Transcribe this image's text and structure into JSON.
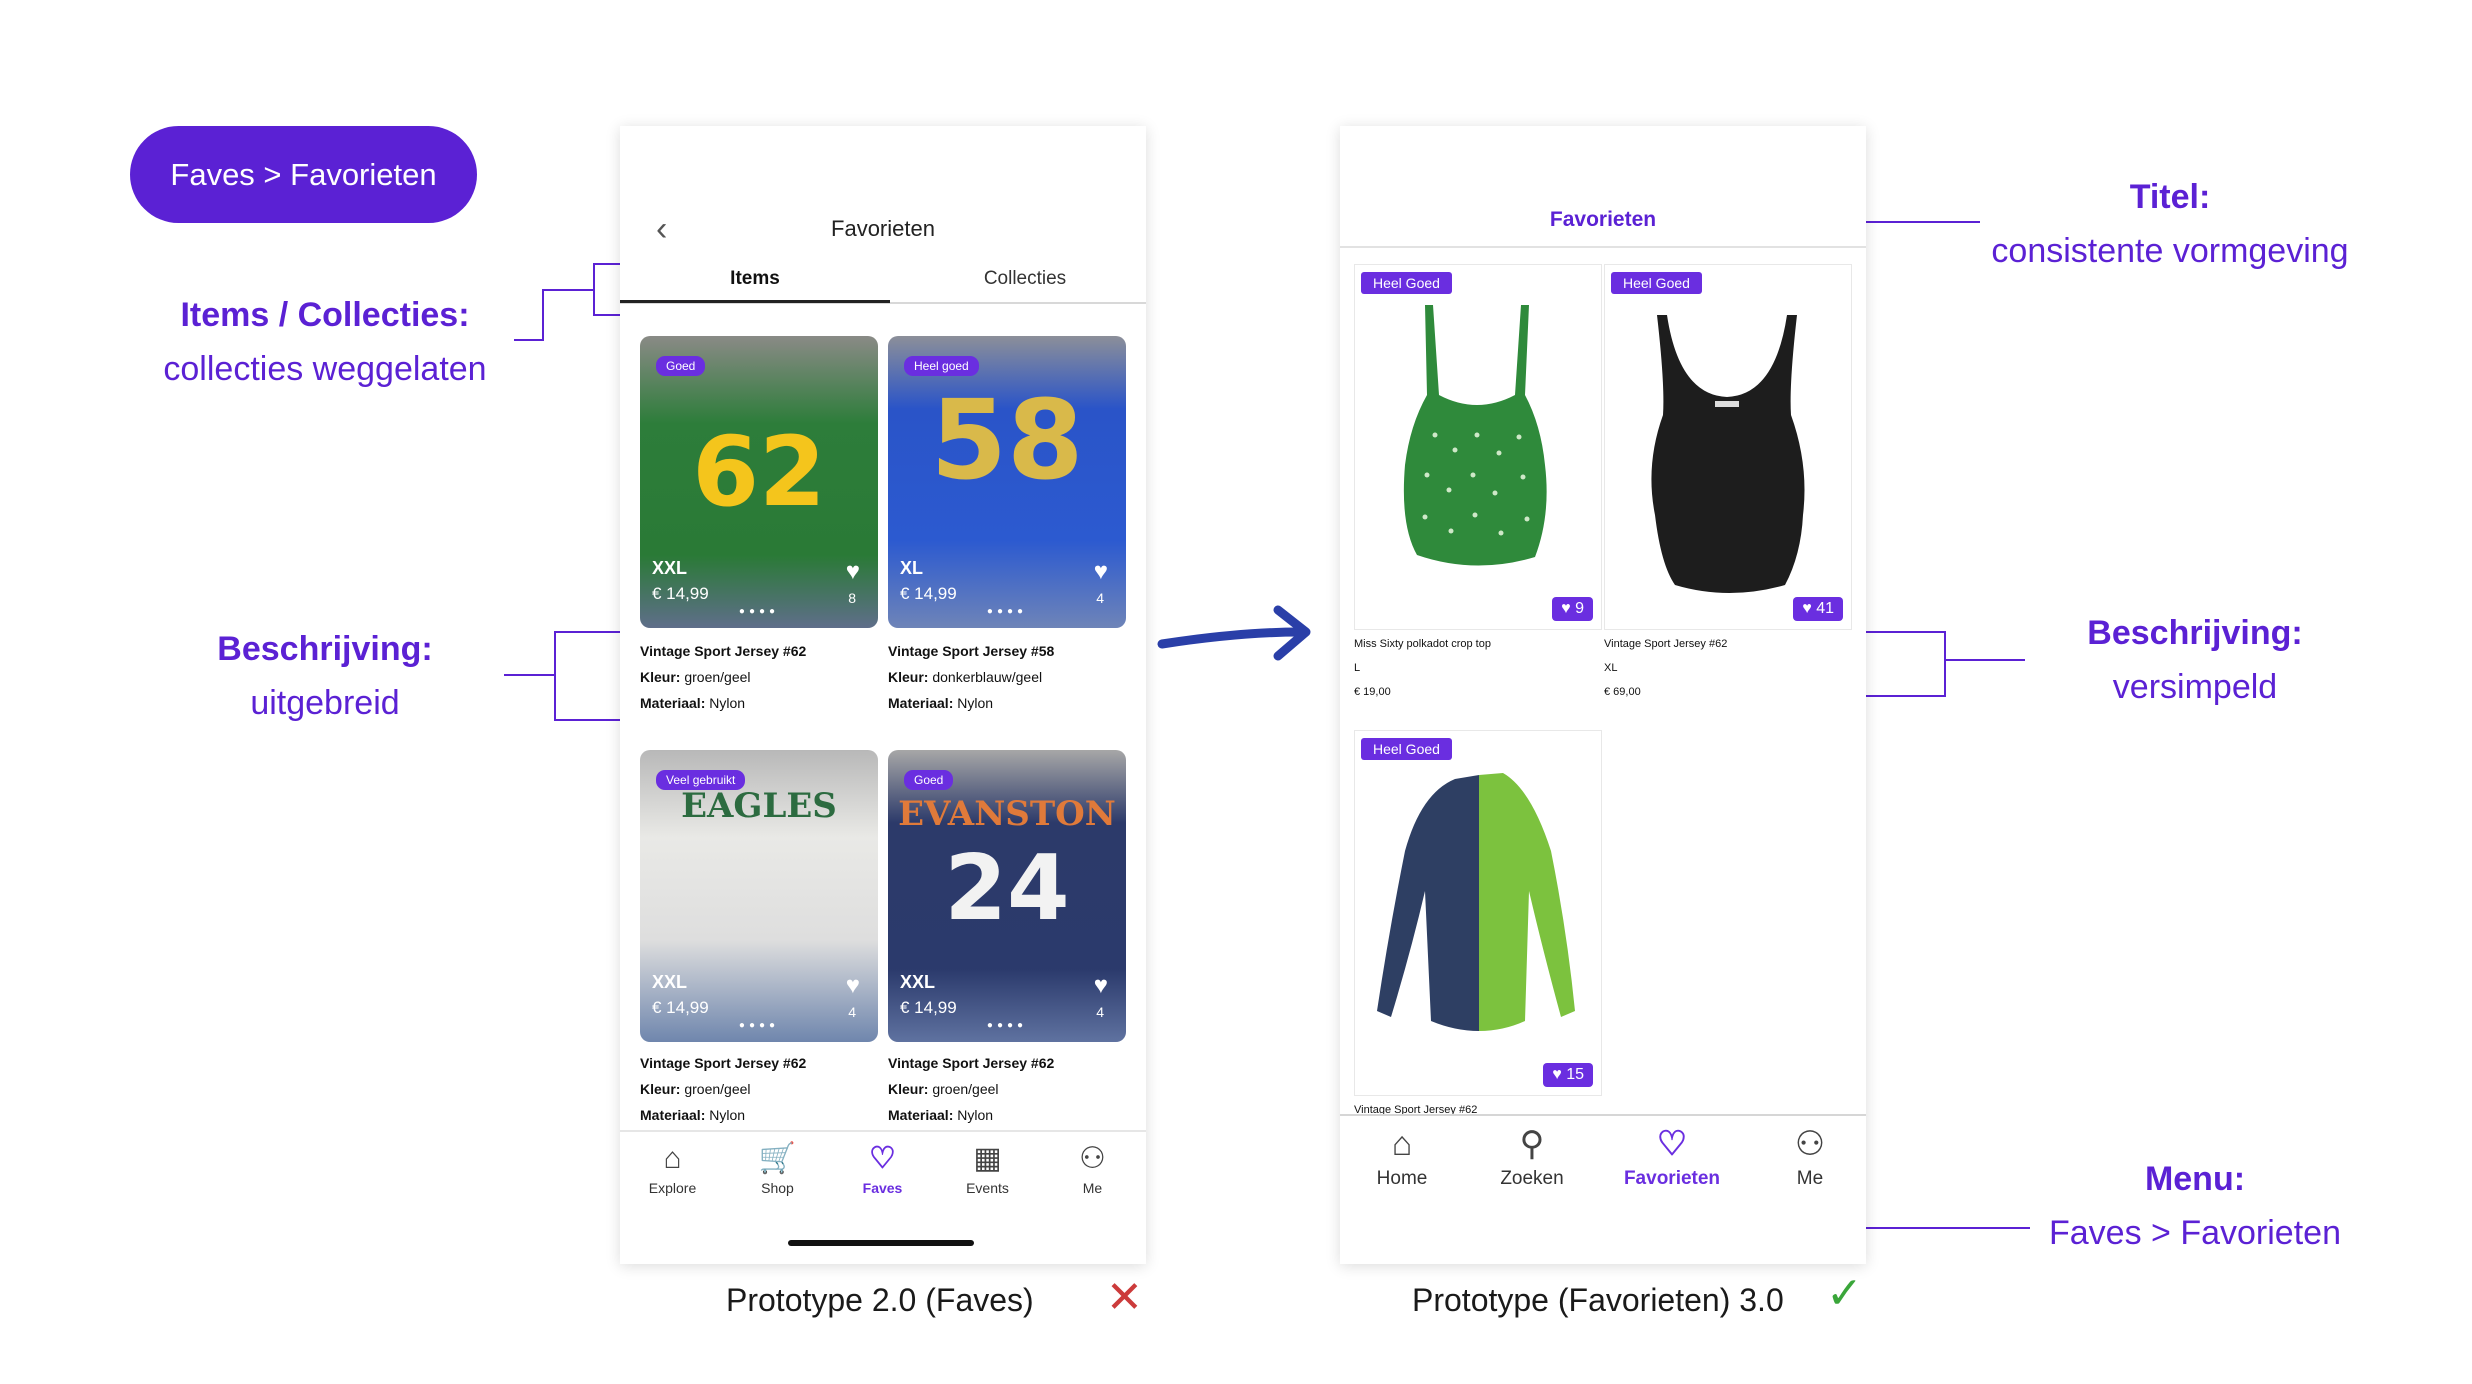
{
  "pill": "Faves > Favorieten",
  "annotations": {
    "items_title": "Items / Collecties:",
    "items_sub": "collecties weggelaten",
    "desc_left_title": "Beschrijving:",
    "desc_left_sub": "uitgebreid",
    "titel_title": "Titel:",
    "titel_sub": "consistente vormgeving",
    "desc_right_title": "Beschrijving:",
    "desc_right_sub": "versimpeld",
    "menu_title": "Menu:",
    "menu_sub": "Faves > Favorieten"
  },
  "captions": {
    "left": "Prototype 2.0 (Faves)",
    "left_mark": "✕",
    "right": "Prototype (Favorieten) 3.0",
    "right_mark": "✓"
  },
  "colors": {
    "accent": "#5b21d4",
    "badge": "#6a2ee0",
    "arrow": "#2a3fa8",
    "cross": "#cc3b3b",
    "check": "#3aa63a"
  },
  "phone_a": {
    "back_icon": "chevron-left-icon",
    "title": "Favorieten",
    "tabs": [
      "Items",
      "Collecties"
    ],
    "cards": [
      {
        "badge": "Goed",
        "size": "XXL",
        "price": "€ 14,99",
        "count": "8",
        "number": "62",
        "name": "Vintage Sport Jersey #62",
        "kleur_label": "Kleur:",
        "kleur": "groen/geel",
        "materiaal_label": "Materiaal:",
        "materiaal": "Nylon"
      },
      {
        "badge": "Heel goed",
        "size": "XL",
        "price": "€ 14,99",
        "count": "4",
        "number": "58",
        "name": "Vintage Sport Jersey #58",
        "kleur_label": "Kleur:",
        "kleur": "donkerblauw/geel",
        "materiaal_label": "Materiaal:",
        "materiaal": "Nylon"
      },
      {
        "badge": "Veel gebruikt",
        "size": "XXL",
        "price": "€ 14,99",
        "count": "4",
        "number": "EAGLES",
        "name": "Vintage Sport Jersey #62",
        "kleur_label": "Kleur:",
        "kleur": "groen/geel",
        "materiaal_label": "Materiaal:",
        "materiaal": "Nylon"
      },
      {
        "badge": "Goed",
        "size": "XXL",
        "price": "€ 14,99",
        "count": "4",
        "number": "24",
        "team": "EVANSTON",
        "name": "Vintage Sport Jersey #62",
        "kleur_label": "Kleur:",
        "kleur": "groen/geel",
        "materiaal_label": "Materiaal:",
        "materiaal": "Nylon"
      }
    ],
    "tabbar": [
      {
        "label": "Explore",
        "icon": "home-icon",
        "glyph": "⌂"
      },
      {
        "label": "Shop",
        "icon": "cart-icon",
        "glyph": "🛒"
      },
      {
        "label": "Faves",
        "icon": "heart-icon",
        "glyph": "♡"
      },
      {
        "label": "Events",
        "icon": "calendar-icon",
        "glyph": "▦"
      },
      {
        "label": "Me",
        "icon": "user-icon",
        "glyph": "⚇"
      }
    ]
  },
  "phone_b": {
    "title": "Favorieten",
    "cards": [
      {
        "badge": "Heel Goed",
        "likes": "9",
        "name": "Miss Sixty polkadot crop top",
        "size": "L",
        "price": "€ 19,00"
      },
      {
        "badge": "Heel Goed",
        "likes": "41",
        "name": "Vintage Sport Jersey #62",
        "size": "XL",
        "price": "€ 69,00"
      },
      {
        "badge": "Heel Goed",
        "likes": "15",
        "name": "Vintage Sport Jersey #62"
      }
    ],
    "tabbar": [
      {
        "label": "Home",
        "icon": "home-icon",
        "glyph": "⌂"
      },
      {
        "label": "Zoeken",
        "icon": "search-icon",
        "glyph": "⚲"
      },
      {
        "label": "Favorieten",
        "icon": "heart-icon",
        "glyph": "♡"
      },
      {
        "label": "Me",
        "icon": "user-icon",
        "glyph": "⚇"
      }
    ]
  }
}
